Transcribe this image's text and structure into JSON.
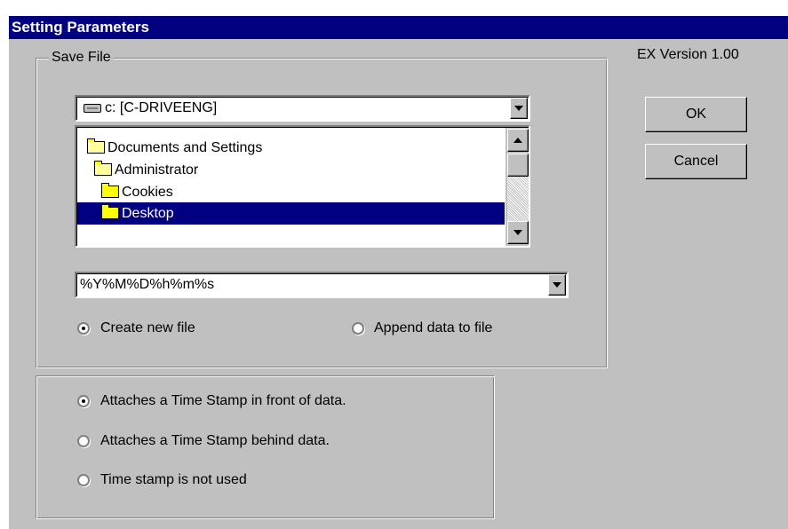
{
  "window": {
    "title": "Setting Parameters",
    "version": "EX Version 1.00"
  },
  "save_file": {
    "group_label": "Save File",
    "drive_combo": {
      "value": "c: [C-DRIVEENG]"
    },
    "folder_tree": [
      {
        "label": "Documents and Settings",
        "icon": "open-folder-icon",
        "selected": false
      },
      {
        "label": "Administrator",
        "icon": "open-folder-icon",
        "selected": false
      },
      {
        "label": "Cookies",
        "icon": "folder-icon",
        "selected": false
      },
      {
        "label": "Desktop",
        "icon": "folder-icon",
        "selected": true
      }
    ],
    "filename_format": {
      "value": "%Y%M%D%h%m%s"
    },
    "mode_options": [
      {
        "label": "Create new file",
        "checked": true
      },
      {
        "label": "Append data to file",
        "checked": false
      }
    ]
  },
  "timestamp_options": [
    {
      "label": "Attaches a Time Stamp in front of data.",
      "checked": true
    },
    {
      "label": "Attaches a Time Stamp behind data.",
      "checked": false
    },
    {
      "label": "Time stamp is not used",
      "checked": false
    }
  ],
  "buttons": {
    "ok": "OK",
    "cancel": "Cancel"
  },
  "colors": {
    "titlebar": "#000080",
    "face": "#c0c0c0",
    "selection": "#000080"
  }
}
